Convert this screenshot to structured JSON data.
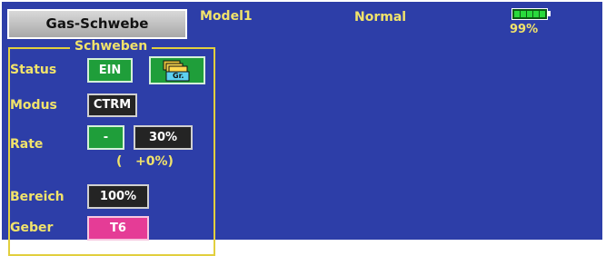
{
  "header": {
    "function_title": "Gas-Schwebe",
    "model": "Model1",
    "condition": "Normal",
    "battery_percent": "99%",
    "battery_level": 0.99
  },
  "group": {
    "title": "Schweben"
  },
  "rows": {
    "status": {
      "label": "Status",
      "value": "EIN",
      "group_button_label": "Gr."
    },
    "modus": {
      "label": "Modus",
      "value": "CTRM"
    },
    "rate": {
      "label": "Rate",
      "sign": "-",
      "value": "30%",
      "trim_display": "(   +0%)"
    },
    "bereich": {
      "label": "Bereich",
      "value": "100%"
    },
    "geber": {
      "label": "Geber",
      "value": "T6"
    }
  },
  "colors": {
    "screen_bg": "#2d3ea8",
    "label_yellow": "#f1e36b",
    "button_green": "#1f9e3a",
    "button_dark": "#242424",
    "button_pink": "#e53c96"
  },
  "icons": {
    "group_button": "folder-group-icon",
    "battery": "battery-icon"
  }
}
